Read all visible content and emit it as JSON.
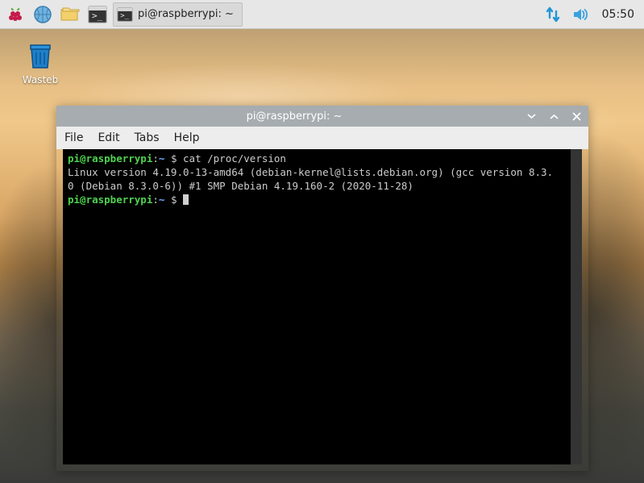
{
  "taskbar": {
    "app_title": "pi@raspberrypi: ~",
    "clock": "05:50"
  },
  "desktop": {
    "wastebasket_label": "Wasteb"
  },
  "window": {
    "title": "pi@raspberrypi: ~",
    "menus": {
      "file": "File",
      "edit": "Edit",
      "tabs": "Tabs",
      "help": "Help"
    },
    "terminal": {
      "prompt_user": "pi@raspberrypi",
      "prompt_sep": ":",
      "prompt_path": "~",
      "prompt_sym": "$",
      "command1": "cat /proc/version",
      "output_line1": "Linux version 4.19.0-13-amd64 (debian-kernel@lists.debian.org) (gcc version 8.3.",
      "output_line2": "0 (Debian 8.3.0-6)) #1 SMP Debian 4.19.160-2 (2020-11-28)"
    }
  }
}
